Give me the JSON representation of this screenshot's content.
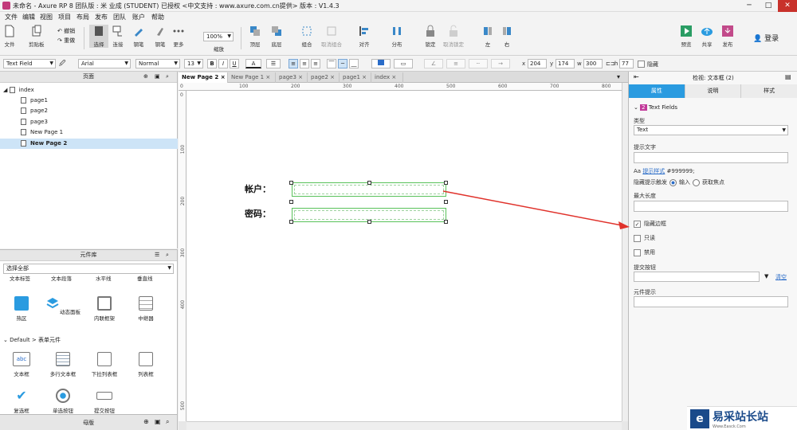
{
  "window": {
    "title": "未命名 - Axure RP 8 团队版 : 米 业成 (STUDENT) 已授权    <中文支持 : www.axure.com.cn提供> 版本 : V1.4.3"
  },
  "menu": [
    "文件",
    "编辑",
    "视图",
    "项目",
    "布局",
    "发布",
    "团队",
    "账户",
    "帮助"
  ],
  "toolbar": {
    "file": "文件",
    "clipboard": "剪贴板",
    "undo": "撤销",
    "redo": "重做",
    "select": "选择",
    "connect": "连接",
    "pen": "钢笔",
    "more": "更多",
    "zoom_value": "100%",
    "zoom": "缩放",
    "top": "顶层",
    "bottom": "底层",
    "group": "组合",
    "ungroup": "取消组合",
    "align": "对齐",
    "distribute": "分布",
    "lock": "锁定",
    "unlock": "取消锁定",
    "left": "左",
    "right": "右",
    "preview": "预览",
    "share": "共享",
    "publish": "发布",
    "login": "登录"
  },
  "format": {
    "widget_type": "Text Field",
    "font": "Arial",
    "style": "Normal",
    "size": "13",
    "bold": "B",
    "italic": "I",
    "underline": "U",
    "text_color": "A",
    "x_label": "x",
    "x": "204",
    "y_label": "y",
    "y": "174",
    "w_label": "w",
    "w": "300",
    "h_label": "h",
    "h": "77",
    "hide": "隐藏"
  },
  "pages_panel": {
    "title": "页面",
    "items": [
      {
        "label": "index"
      },
      {
        "label": "page1"
      },
      {
        "label": "page2"
      },
      {
        "label": "page3"
      },
      {
        "label": "New Page 1"
      },
      {
        "label": "New Page 2"
      }
    ]
  },
  "library": {
    "title": "元件库",
    "select_all": "选择全部",
    "cut_row": [
      "文本标签",
      "文本段落",
      "水平线",
      "垂直线"
    ],
    "row1": [
      "热区",
      "动态面板",
      "内联框架",
      "中继器"
    ],
    "group": "Default > 表单元件",
    "row2": [
      "文本框",
      "多行文本框",
      "下拉列表框",
      "列表框"
    ],
    "row3": [
      "复选框",
      "单选按钮",
      "提交按钮"
    ]
  },
  "masters": {
    "title": "母版"
  },
  "tabs": [
    "New Page 2",
    "New Page 1",
    "page3",
    "page2",
    "page1",
    "index"
  ],
  "ruler_h": [
    "0",
    "100",
    "200",
    "300",
    "400",
    "500",
    "600",
    "700",
    "800"
  ],
  "ruler_v": [
    "0",
    "100",
    "200",
    "300",
    "400",
    "500"
  ],
  "canvas": {
    "account_label": "帐户：",
    "password_label": "密码："
  },
  "inspector": {
    "title": "检视: 文本框 (2)",
    "tabs": [
      "属性",
      "说明",
      "样式"
    ],
    "section_num": "2",
    "section": "Text Fields",
    "type_label": "类型",
    "type_value": "Text",
    "hint_text_label": "提示文字",
    "hint_style_link": "提示样式",
    "hint_color": "#999999;",
    "hide_hint_label": "隐藏提示触发",
    "on_input": "输入",
    "on_focus": "获取焦点",
    "max_length_label": "最大长度",
    "hide_border": "隐藏边框",
    "readonly": "只读",
    "disabled": "禁用",
    "submit_button_label": "提交按钮",
    "clear": "清空",
    "tooltip_label": "元件提示"
  },
  "watermark": {
    "name": "易采站长站",
    "url": "Www.Easck.Com"
  },
  "colors": {
    "accent": "#2a9be0",
    "arrow": "#e0322b",
    "selection": "#58c25a"
  }
}
